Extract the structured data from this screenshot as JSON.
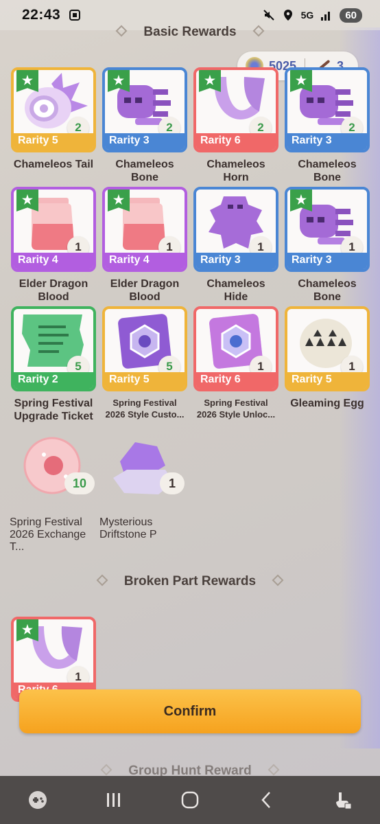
{
  "status": {
    "time": "22:43",
    "network": "5G",
    "battery": "60"
  },
  "currency": {
    "paw_value": "5025",
    "blade_value": "3"
  },
  "sections": {
    "basic": "Basic Rewards",
    "broken": "Broken Part Rewards",
    "group": "Group Hunt Reward"
  },
  "items": [
    {
      "name": "Chameleos Tail",
      "rarity": "Rarity 5",
      "count": "2"
    },
    {
      "name": "Chameleos Bone",
      "rarity": "Rarity 3",
      "count": "2"
    },
    {
      "name": "Chameleos Horn",
      "rarity": "Rarity 6",
      "count": "2"
    },
    {
      "name": "Chameleos Bone",
      "rarity": "Rarity 3",
      "count": "2"
    },
    {
      "name": "Elder Dragon Blood",
      "rarity": "Rarity 4",
      "count": "1"
    },
    {
      "name": "Elder Dragon Blood",
      "rarity": "Rarity 4",
      "count": "1"
    },
    {
      "name": "Chameleos Hide",
      "rarity": "Rarity 3",
      "count": "1"
    },
    {
      "name": "Chameleos Bone",
      "rarity": "Rarity 3",
      "count": "1"
    },
    {
      "name": "Spring Festival Upgrade Ticket",
      "rarity": "Rarity 2",
      "count": "5"
    },
    {
      "name": "Spring Festival 2026 Style Custo...",
      "rarity": "Rarity 5",
      "count": "5"
    },
    {
      "name": "Spring Festival 2026 Style Unloc...",
      "rarity": "Rarity 6",
      "count": "1"
    },
    {
      "name": "Gleaming Egg",
      "rarity": "Rarity 5",
      "count": "1"
    },
    {
      "name": "Spring Festival 2026 Exchange T...",
      "count": "10"
    },
    {
      "name": "Mysterious Driftstone P",
      "count": "1"
    }
  ],
  "broken_items": [
    {
      "rarity": "Rarity 6",
      "count": "1"
    }
  ],
  "confirm_label": "Confirm",
  "colors": {
    "rarity2": "#3fb35e",
    "rarity3": "#4a86d4",
    "rarity4": "#b25ee0",
    "rarity5": "#efb43a",
    "rarity6": "#f06868",
    "confirm": "#f6a21e"
  }
}
